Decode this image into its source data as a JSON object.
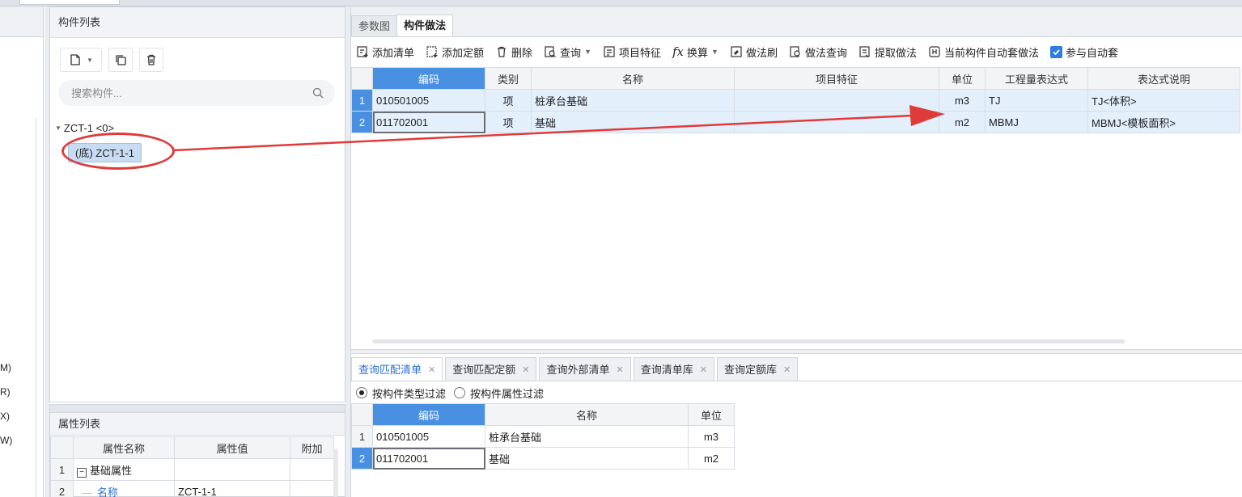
{
  "left_fragments": [
    "M)",
    "R)",
    "X)",
    "W)"
  ],
  "component_panel": {
    "title": "构件列表",
    "search_placeholder": "搜索构件...",
    "tree_root": "ZCT-1 <0>",
    "tree_child": "(底) ZCT-1-1"
  },
  "property_panel": {
    "title": "属性列表",
    "headers": [
      "属性名称",
      "属性值",
      "附加"
    ],
    "rows": [
      {
        "n": "1",
        "name": "基础属性",
        "value": ""
      },
      {
        "n": "2",
        "name": "名称",
        "value": "ZCT-1-1"
      }
    ]
  },
  "right_tabs": [
    "参数图",
    "构件做法"
  ],
  "toolbar": [
    {
      "label": "添加清单"
    },
    {
      "label": "添加定额"
    },
    {
      "label": "删除"
    },
    {
      "label": "查询"
    },
    {
      "label": "项目特征"
    },
    {
      "label": "换算"
    },
    {
      "label": "做法刷"
    },
    {
      "label": "做法查询"
    },
    {
      "label": "提取做法"
    },
    {
      "label": "当前构件自动套做法"
    },
    {
      "label": "参与自动套"
    }
  ],
  "main_table": {
    "headers": [
      "编码",
      "类别",
      "名称",
      "项目特征",
      "单位",
      "工程量表达式",
      "表达式说明"
    ],
    "rows": [
      {
        "n": "1",
        "code": "010501005",
        "type": "项",
        "name": "桩承台基础",
        "feature": "",
        "unit": "m3",
        "expr": "TJ",
        "desc": "TJ<体积>"
      },
      {
        "n": "2",
        "code": "011702001",
        "type": "项",
        "name": "基础",
        "feature": "",
        "unit": "m2",
        "expr": "MBMJ",
        "desc": "MBMJ<模板面积>"
      }
    ]
  },
  "lower_tabs": [
    "查询匹配清单",
    "查询匹配定额",
    "查询外部清单",
    "查询清单库",
    "查询定额库"
  ],
  "filters": [
    "按构件类型过滤",
    "按构件属性过滤"
  ],
  "lower_table": {
    "headers": [
      "编码",
      "名称",
      "单位"
    ],
    "rows": [
      {
        "n": "1",
        "code": "010501005",
        "name": "桩承台基础",
        "unit": "m3"
      },
      {
        "n": "2",
        "code": "011702001",
        "name": "基础",
        "unit": "m2"
      }
    ]
  },
  "colors": {
    "accent": "#4a90e2",
    "annotation": "#e03a3a"
  }
}
